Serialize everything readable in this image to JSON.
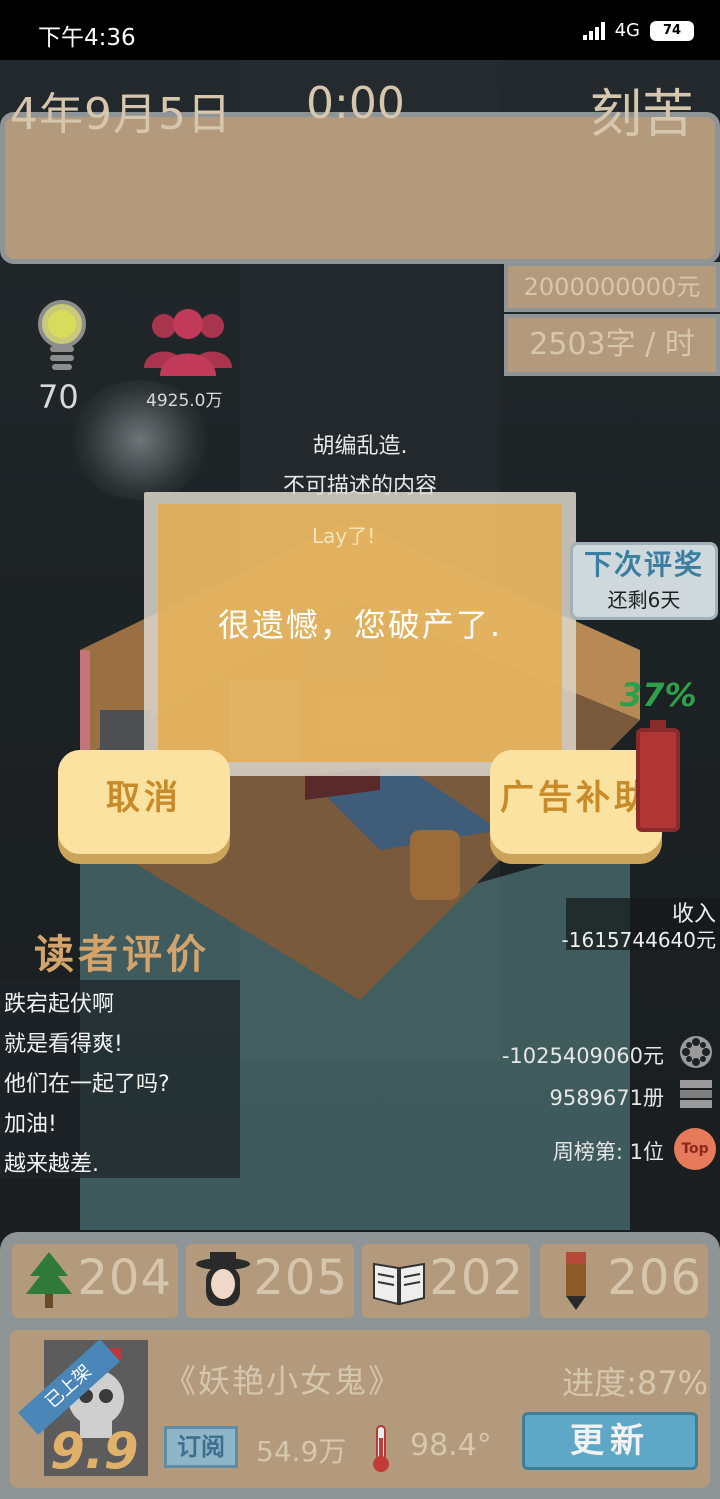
{
  "status_bar": {
    "time": "下午4:36",
    "network": "4G",
    "battery": "74"
  },
  "header": {
    "date": "4年9月5日",
    "clock": "0:00",
    "mood": "刻苦",
    "money": "2000000000元",
    "speed": "2503字 / 时"
  },
  "stats": {
    "inspiration": "70",
    "fans": "4925.0万"
  },
  "tags": {
    "line1": "胡编乱造.",
    "line2": "不可描述的内容"
  },
  "modal": {
    "sub": "Lay了!",
    "message": "很遗憾，您破产了.",
    "cancel_label": "取消",
    "ad_label": "广告补助"
  },
  "award": {
    "title": "下次评奖",
    "remaining": "还剩6天"
  },
  "battery_pct": "37%",
  "income": {
    "label": "收入",
    "value": "-1615744640元"
  },
  "reviews": {
    "title": "读者评价",
    "items": [
      "跌宕起伏啊",
      "就是看得爽!",
      "他们在一起了吗?",
      "加油!",
      "越来越差."
    ]
  },
  "side_stats": {
    "cost": "-1025409060元",
    "copies": "9589671册",
    "rank": "周榜第: 1位",
    "top_badge": "Top"
  },
  "attributes": [
    {
      "value": "204",
      "icon": "tree-icon"
    },
    {
      "value": "205",
      "icon": "character-icon"
    },
    {
      "value": "202",
      "icon": "book-icon"
    },
    {
      "value": "206",
      "icon": "pencil-icon"
    }
  ],
  "book": {
    "ribbon": "已上架",
    "score": "9.9",
    "title": "《妖艳小女鬼》",
    "progress": "进度:87%",
    "subscribe_label": "订阅",
    "subscribers": "54.9万",
    "heat": "98.4°",
    "update_label": "更新"
  },
  "colors": {
    "panel": "#b39a7c",
    "panel_border": "#8f9497",
    "modal_fill": "#e6aa46",
    "button": "#fbe2a0",
    "accent_blue": "#5fa7c6"
  }
}
